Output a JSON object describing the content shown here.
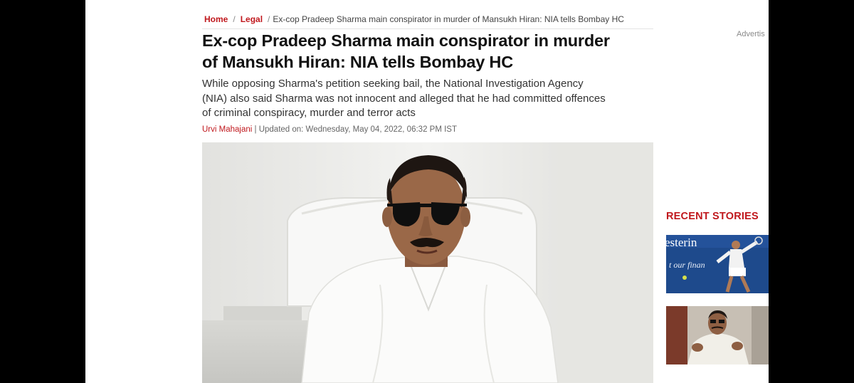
{
  "breadcrumb": {
    "home": "Home",
    "legal": "Legal",
    "current": "Ex-cop Pradeep Sharma main conspirator in murder of Mansukh Hiran: NIA tells Bombay HC"
  },
  "advert_label": "Advertis",
  "article": {
    "headline_line1": "Ex-cop Pradeep Sharma main conspirator in murder",
    "headline_line2": "of Mansukh Hiran: NIA tells Bombay HC",
    "summary_line1": "While opposing Sharma's petition seeking bail, the National Investigation Agency",
    "summary_line2": "(NIA) also said Sharma was not innocent and alleged that he had committed offences",
    "summary_line3": "of criminal conspiracy, murder and terror acts",
    "author": "Urvi Mahajani",
    "updated": "| Updated on: Wednesday, May 04, 2022, 06:32 PM IST"
  },
  "recent": {
    "title": "RECENT STORIES",
    "thumb1_text_top": "esterin",
    "thumb1_text_bottom": "t our finan"
  },
  "colors": {
    "brand_red": "#c0181d",
    "headline": "#111111",
    "body_text": "#333333"
  }
}
